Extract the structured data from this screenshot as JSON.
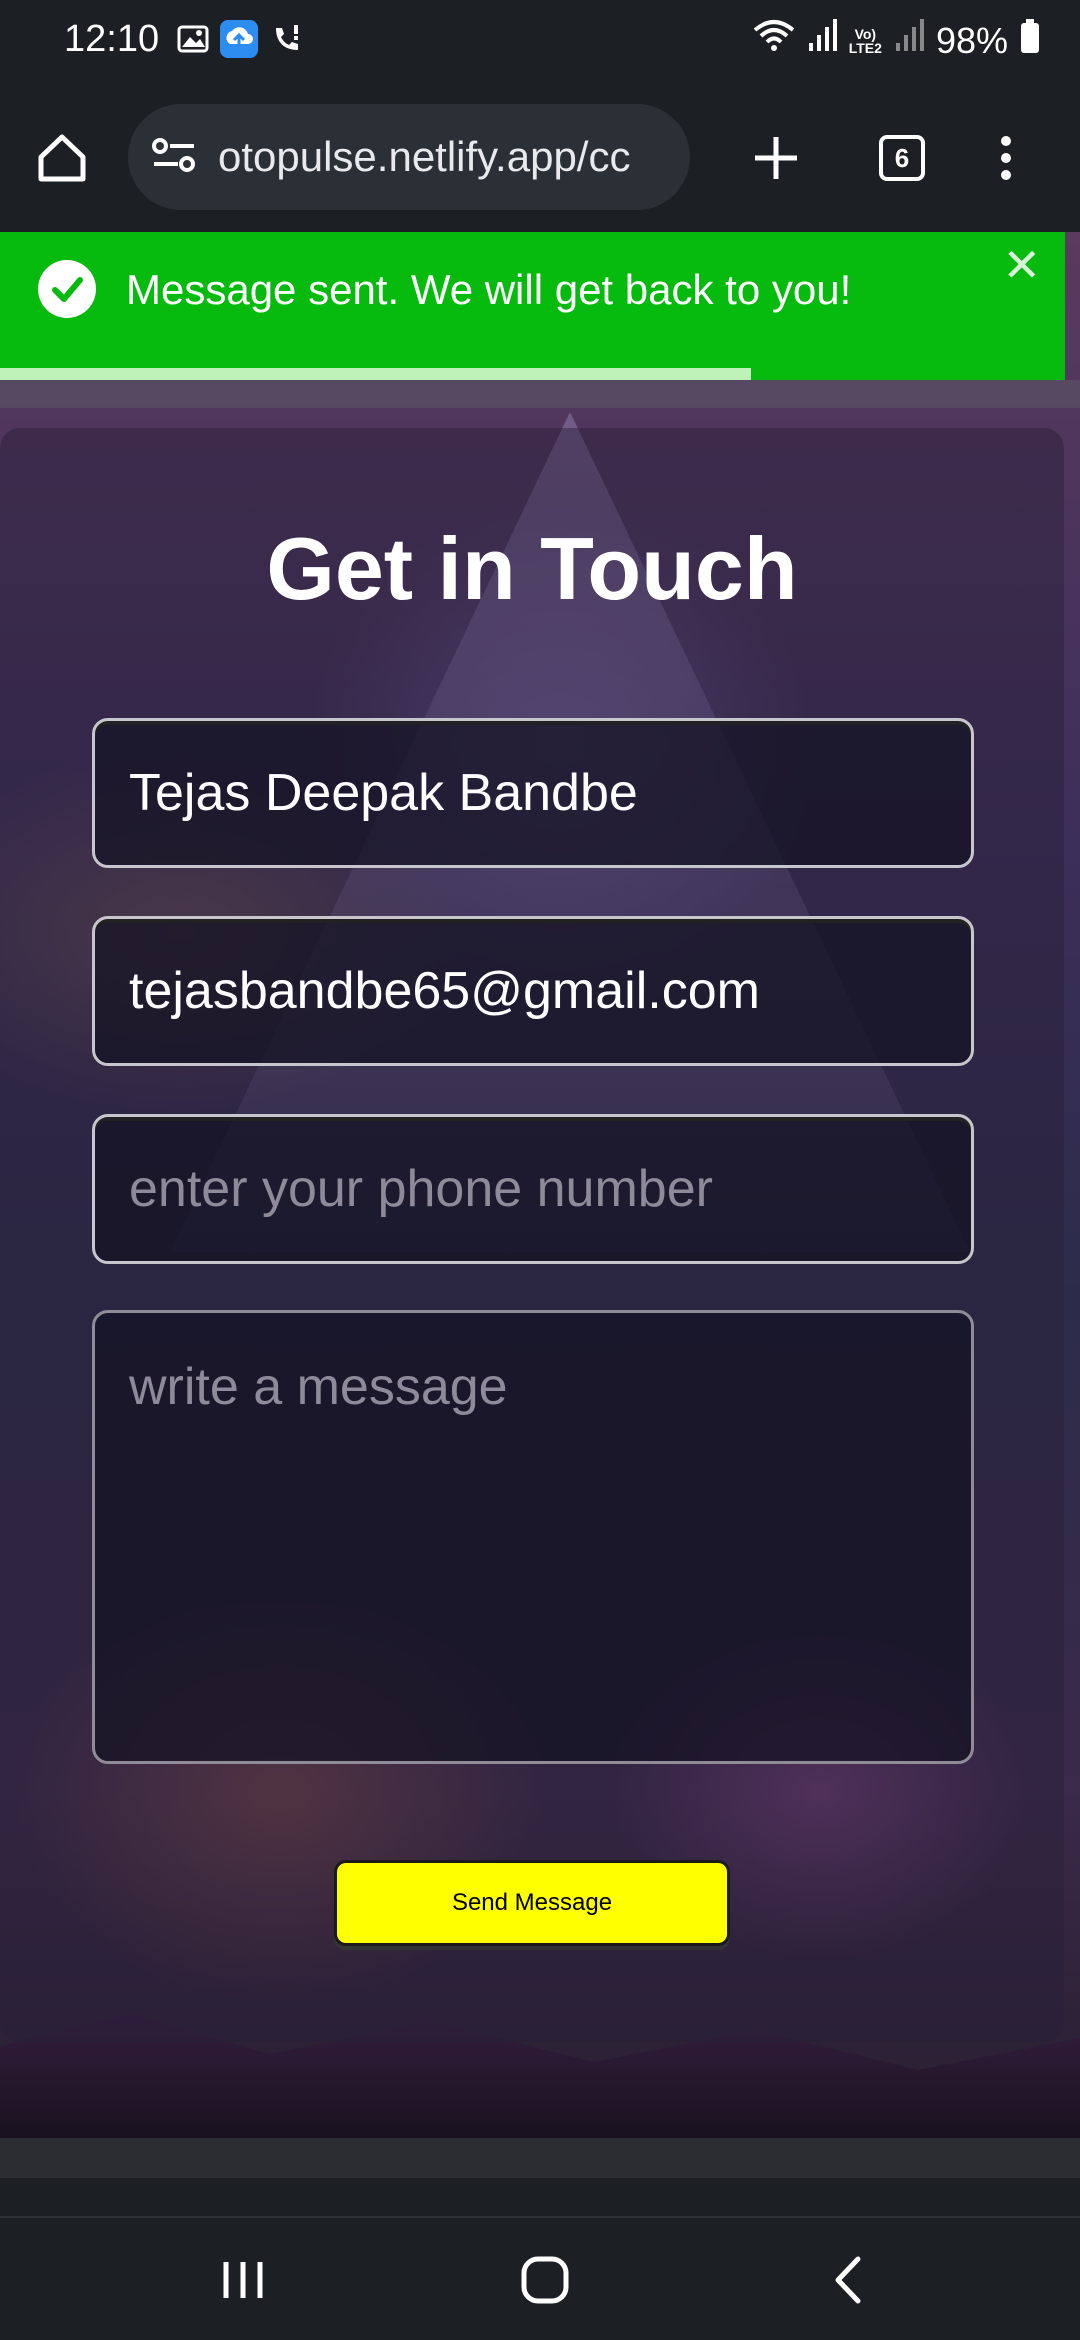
{
  "status_bar": {
    "time": "12:10",
    "battery": "98%",
    "network_label_top": "Vo)",
    "network_label_bottom": "LTE2",
    "icons": [
      "gallery-icon",
      "cloud-upload-icon",
      "missed-call-icon",
      "wifi-icon",
      "signal-icon",
      "signal-icon-2",
      "battery-icon"
    ]
  },
  "browser": {
    "url": "otopulse.netlify.app/cc",
    "tab_count": "6",
    "icons": [
      "home-icon",
      "site-settings-icon",
      "new-tab-icon",
      "tab-switcher-icon",
      "more-menu-icon"
    ]
  },
  "toast": {
    "message": "Message sent. We will get back to you!",
    "close_symbol": "✕",
    "color": "#07bb0e",
    "progress_remaining": 0.705
  },
  "contact": {
    "title": "Get in Touch",
    "name_value": "Tejas Deepak Bandbe",
    "email_value": "tejasbandbe65@gmail.com",
    "phone_placeholder": "enter your phone number",
    "message_placeholder": "write a message",
    "submit_label": "Send Message",
    "submit_color": "#ffff00"
  },
  "nav": {
    "icons": [
      "recent-apps-icon",
      "home-nav-icon",
      "back-icon"
    ]
  }
}
